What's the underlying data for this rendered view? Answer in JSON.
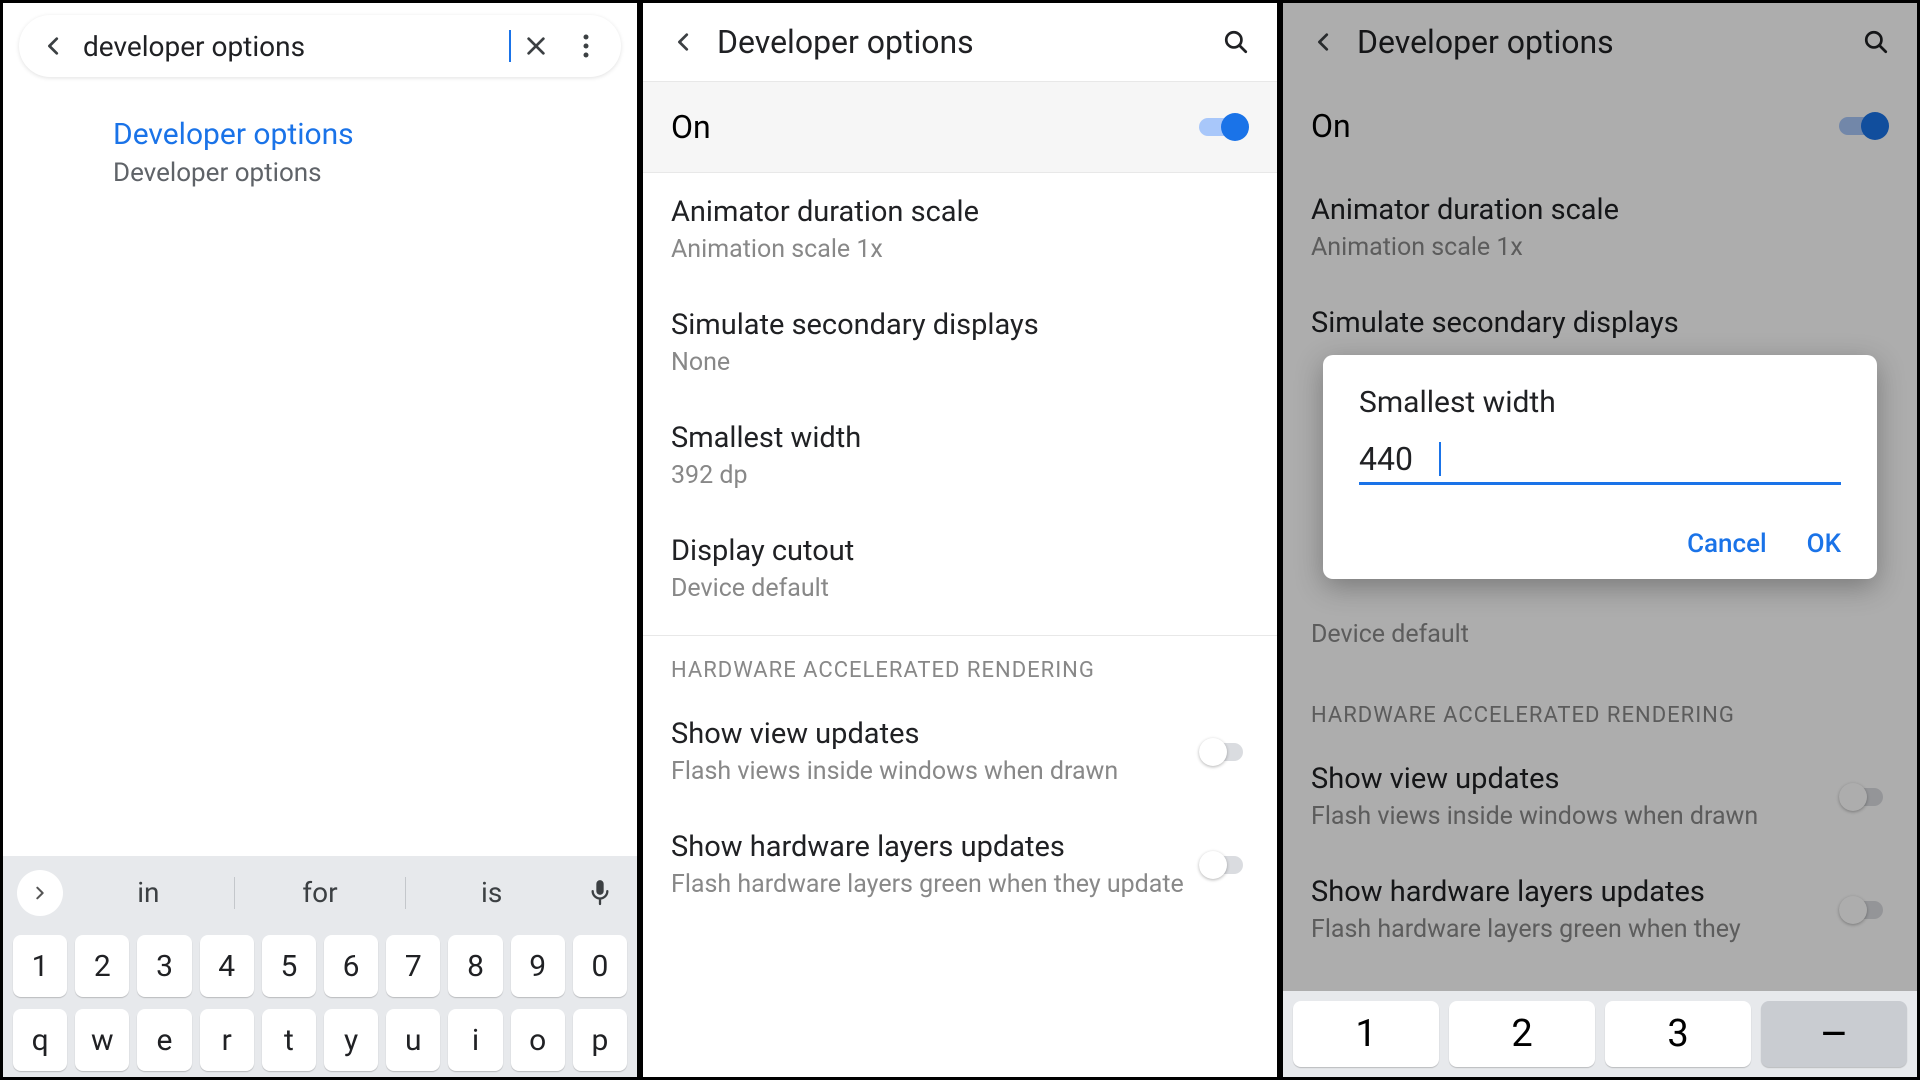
{
  "panel1": {
    "search_value": "developer options",
    "result_title": "Developer options",
    "result_sub": "Developer options",
    "suggestions": [
      "in",
      "for",
      "is"
    ],
    "num_row": [
      "1",
      "2",
      "3",
      "4",
      "5",
      "6",
      "7",
      "8",
      "9",
      "0"
    ],
    "letter_row": [
      "q",
      "w",
      "e",
      "r",
      "t",
      "y",
      "u",
      "i",
      "o",
      "p"
    ]
  },
  "panel2": {
    "title": "Developer options",
    "on_label": "On",
    "items": [
      {
        "title": "Animator duration scale",
        "sub": "Animation scale 1x"
      },
      {
        "title": "Simulate secondary displays",
        "sub": "None"
      },
      {
        "title": "Smallest width",
        "sub": "392 dp"
      },
      {
        "title": "Display cutout",
        "sub": "Device default"
      }
    ],
    "section": "HARDWARE ACCELERATED RENDERING",
    "toggles": [
      {
        "title": "Show view updates",
        "sub": "Flash views inside windows when drawn"
      },
      {
        "title": "Show hardware layers updates",
        "sub": "Flash hardware layers green when they update"
      }
    ]
  },
  "panel3": {
    "title": "Developer options",
    "on_label": "On",
    "items": [
      {
        "title": "Animator duration scale",
        "sub": "Animation scale 1x"
      },
      {
        "title": "Simulate secondary displays",
        "sub": ""
      }
    ],
    "dialog": {
      "title": "Smallest width",
      "value": "440",
      "cancel": "Cancel",
      "ok": "OK"
    },
    "cutout_sub": "Device default",
    "section": "HARDWARE ACCELERATED RENDERING",
    "toggles": [
      {
        "title": "Show view updates",
        "sub": "Flash views inside windows when drawn"
      },
      {
        "title": "Show hardware layers updates",
        "sub": "Flash hardware layers green when they"
      }
    ],
    "numpad": [
      "1",
      "2",
      "3",
      "–"
    ]
  }
}
